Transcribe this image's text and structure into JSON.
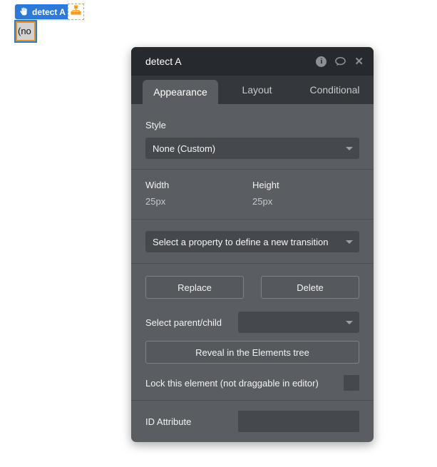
{
  "canvas": {
    "element_badge": {
      "label": "detect A"
    },
    "clipped_element_text": "(no"
  },
  "panel": {
    "title": "detect A",
    "tabs": [
      {
        "label": "Appearance",
        "active": true
      },
      {
        "label": "Layout",
        "active": false
      },
      {
        "label": "Conditional",
        "active": false
      }
    ],
    "style_section": {
      "label": "Style",
      "value": "None (Custom)"
    },
    "dimensions": {
      "width_label": "Width",
      "width_value": "25px",
      "height_label": "Height",
      "height_value": "25px"
    },
    "transition": {
      "placeholder": "Select a property to define a new transition"
    },
    "actions": {
      "replace_label": "Replace",
      "delete_label": "Delete"
    },
    "parent_child": {
      "label": "Select parent/child",
      "value": ""
    },
    "reveal_label": "Reveal in the Elements tree",
    "lock": {
      "label": "Lock this element (not draggable in editor)",
      "checked": false
    },
    "id_attribute": {
      "label": "ID Attribute",
      "value": ""
    }
  },
  "icons": {
    "header": [
      "info-icon",
      "comment-bubble-icon",
      "close-icon"
    ],
    "badge": "hand-icon",
    "canvas": "hierarchy-icon"
  },
  "colors": {
    "badge_blue": "#2e79d8",
    "selection_orange": "#e0912d",
    "selection_blue": "#2d7dc3",
    "panel_header": "#26292d",
    "panel_body": "#5a5e63",
    "input_bg": "#45494e"
  }
}
